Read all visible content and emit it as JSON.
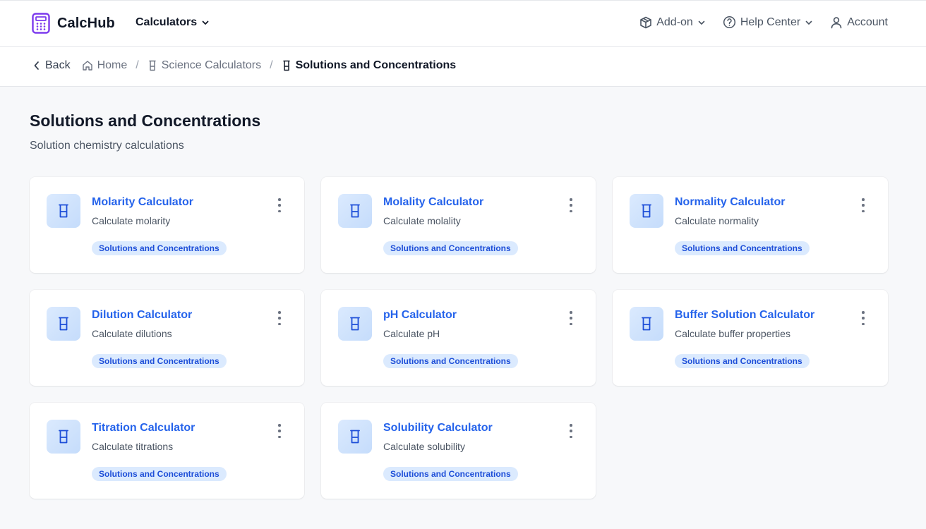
{
  "header": {
    "brand": "CalcHub",
    "calculators_label": "Calculators",
    "addon_label": "Add-on",
    "help_label": "Help Center",
    "account_label": "Account"
  },
  "breadcrumb": {
    "back_label": "Back",
    "home_label": "Home",
    "science_label": "Science Calculators",
    "current_label": "Solutions and Concentrations"
  },
  "page": {
    "title": "Solutions and Concentrations",
    "subtitle": "Solution chemistry calculations"
  },
  "cards": [
    {
      "title": "Molarity Calculator",
      "desc": "Calculate molarity",
      "tag": "Solutions and Concentrations"
    },
    {
      "title": "Molality Calculator",
      "desc": "Calculate molality",
      "tag": "Solutions and Concentrations"
    },
    {
      "title": "Normality Calculator",
      "desc": "Calculate normality",
      "tag": "Solutions and Concentrations"
    },
    {
      "title": "Dilution Calculator",
      "desc": "Calculate dilutions",
      "tag": "Solutions and Concentrations"
    },
    {
      "title": "pH Calculator",
      "desc": "Calculate pH",
      "tag": "Solutions and Concentrations"
    },
    {
      "title": "Buffer Solution Calculator",
      "desc": "Calculate buffer properties",
      "tag": "Solutions and Concentrations"
    },
    {
      "title": "Titration Calculator",
      "desc": "Calculate titrations",
      "tag": "Solutions and Concentrations"
    },
    {
      "title": "Solubility Calculator",
      "desc": "Calculate solubility",
      "tag": "Solutions and Concentrations"
    }
  ],
  "icons": {
    "logo": "calculator-icon",
    "card": "beaker-icon",
    "menu": "more-vertical-icon"
  },
  "colors": {
    "brand": "#7c3aed",
    "link": "#2563eb",
    "tag_bg": "#dbeafe",
    "tag_text": "#1d4ed8"
  }
}
